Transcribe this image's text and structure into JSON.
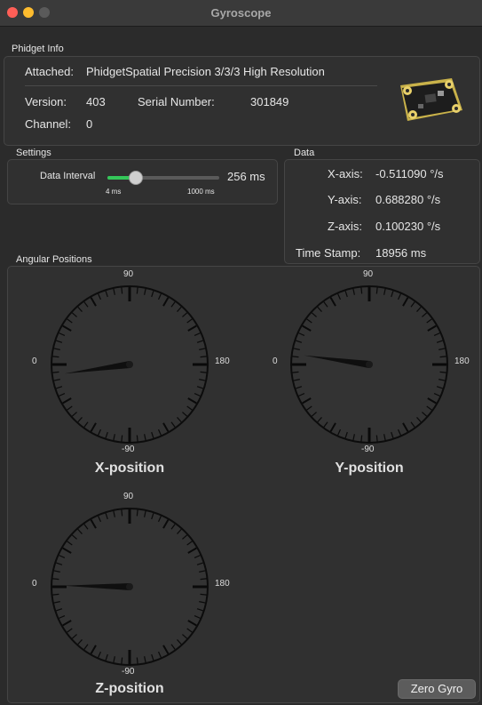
{
  "window": {
    "title": "Gyroscope"
  },
  "phidget_info": {
    "label": "Phidget Info",
    "attached_label": "Attached:",
    "attached_value": "PhidgetSpatial Precision 3/3/3 High Resolution",
    "version_label": "Version:",
    "version_value": "403",
    "serial_label": "Serial Number:",
    "serial_value": "301849",
    "channel_label": "Channel:",
    "channel_value": "0"
  },
  "settings": {
    "label": "Settings",
    "interval_label": "Data Interval",
    "interval_value": "256 ms",
    "min_label": "4 ms",
    "max_label": "1000 ms",
    "slider_fraction": 0.255
  },
  "data": {
    "label": "Data",
    "x_label": "X-axis:",
    "x_value": "-0.511090 °/s",
    "y_label": "Y-axis:",
    "y_value": "0.688280 °/s",
    "z_label": "Z-axis:",
    "z_value": "0.100230 °/s",
    "ts_label": "Time Stamp:",
    "ts_value": "18956 ms"
  },
  "angular": {
    "label": "Angular Positions",
    "scale": {
      "top": "90",
      "left": "0",
      "right": "180",
      "bottom": "-90"
    },
    "gauges": [
      {
        "name": "X-position",
        "needle_deg": 8
      },
      {
        "name": "Y-position",
        "needle_deg": -8
      },
      {
        "name": "Z-position",
        "needle_deg": -1
      }
    ]
  },
  "buttons": {
    "zero_gyro": "Zero Gyro"
  },
  "colors": {
    "accent": "#34c759",
    "close": "#ff5f57",
    "minimize": "#febc2e"
  }
}
